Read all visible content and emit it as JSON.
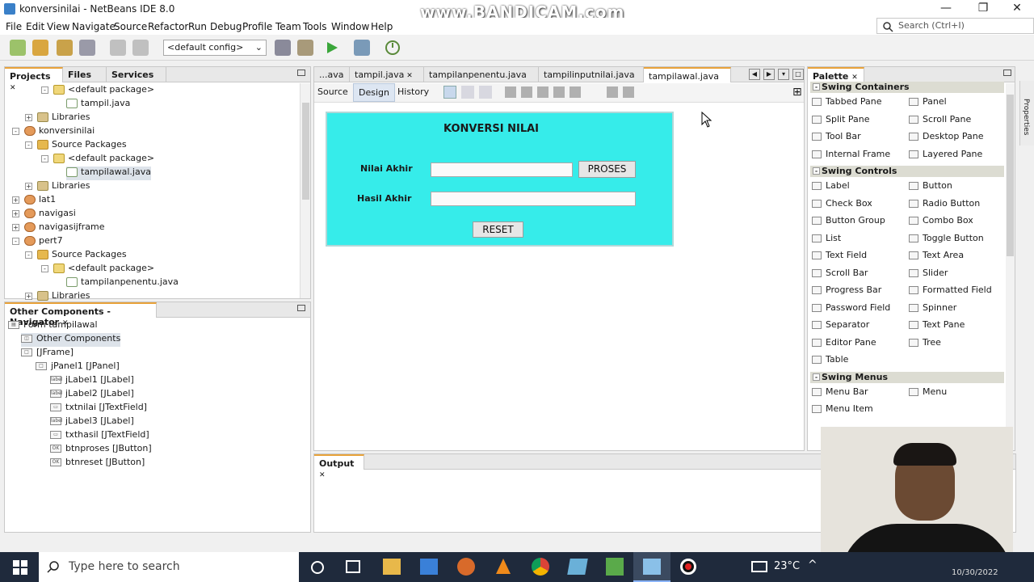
{
  "window": {
    "title": "konversinilai - NetBeans IDE 8.0",
    "minimize": "—",
    "maximize": "❐",
    "close": "✕"
  },
  "watermark": "www.BANDICAM.com",
  "menu": [
    "File",
    "Edit",
    "View",
    "Navigate",
    "Source",
    "Refactor",
    "Run",
    "Debug",
    "Profile",
    "Team",
    "Tools",
    "Window",
    "Help"
  ],
  "search": {
    "placeholder": "Search (Ctrl+I)"
  },
  "toolbar": {
    "config": "<default config>"
  },
  "projects": {
    "tabs": [
      "Projects",
      "Files",
      "Services"
    ],
    "tree": [
      {
        "label": "<default package>",
        "icon": "pkg"
      },
      {
        "label": "tampil.java",
        "icon": "java"
      },
      {
        "label": "Libraries",
        "icon": "lib"
      },
      {
        "label": "konversinilai",
        "icon": "proj"
      },
      {
        "label": "Source Packages",
        "icon": "folder"
      },
      {
        "label": "<default package>",
        "icon": "pkg"
      },
      {
        "label": "tampilawal.java",
        "icon": "java"
      },
      {
        "label": "Libraries",
        "icon": "lib"
      },
      {
        "label": "lat1",
        "icon": "proj"
      },
      {
        "label": "navigasi",
        "icon": "proj"
      },
      {
        "label": "navigasijframe",
        "icon": "proj"
      },
      {
        "label": "pert7",
        "icon": "proj"
      },
      {
        "label": "Source Packages",
        "icon": "folder"
      },
      {
        "label": "<default package>",
        "icon": "pkg"
      },
      {
        "label": "tampilanpenentu.java",
        "icon": "java"
      },
      {
        "label": "Libraries",
        "icon": "lib"
      }
    ]
  },
  "navigator": {
    "title": "Other Components - Navigator",
    "items": [
      {
        "label": "Form tampilawal",
        "icon": "form"
      },
      {
        "label": "Other Components",
        "icon": "comp"
      },
      {
        "label": "[JFrame]",
        "icon": "frame"
      },
      {
        "label": "jPanel1 [JPanel]",
        "icon": "panel"
      },
      {
        "label": "jLabel1 [JLabel]",
        "icon": "label"
      },
      {
        "label": "jLabel2 [JLabel]",
        "icon": "label"
      },
      {
        "label": "txtnilai [JTextField]",
        "icon": "field"
      },
      {
        "label": "jLabel3 [JLabel]",
        "icon": "label"
      },
      {
        "label": "txthasil [JTextField]",
        "icon": "field"
      },
      {
        "label": "btnproses [JButton]",
        "icon": "button"
      },
      {
        "label": "btnreset [JButton]",
        "icon": "button"
      }
    ]
  },
  "editor": {
    "tabs": [
      "...ava",
      "tampil.java",
      "tampilanpenentu.java",
      "tampilinputnilai.java",
      "tampilawal.java"
    ],
    "modes": [
      "Source",
      "Design",
      "History"
    ]
  },
  "form": {
    "title": "KONVERSI NILAI",
    "nilai_label": "Nilai Akhir",
    "hasil_label": "Hasil Akhir",
    "proses": "PROSES",
    "reset": "RESET",
    "bg_color": "#36ecea"
  },
  "output": {
    "title": "Output"
  },
  "palette": {
    "title": "Palette",
    "sections": [
      {
        "name": "Swing Containers",
        "items": [
          "Tabbed Pane",
          "Panel",
          "Split Pane",
          "Scroll Pane",
          "Tool Bar",
          "Desktop Pane",
          "Internal Frame",
          "Layered Pane"
        ]
      },
      {
        "name": "Swing Controls",
        "items": [
          "Label",
          "Button",
          "Check Box",
          "Radio Button",
          "Button Group",
          "Combo Box",
          "List",
          "Toggle Button",
          "Text Field",
          "Text Area",
          "Scroll Bar",
          "Slider",
          "Progress Bar",
          "Formatted Field",
          "Password Field",
          "Spinner",
          "Separator",
          "Text Pane",
          "Editor Pane",
          "Tree",
          "Table"
        ]
      },
      {
        "name": "Swing Menus",
        "items": [
          "Menu Bar",
          "Menu",
          "Menu Item"
        ]
      }
    ],
    "properties_tab": "Properties"
  },
  "taskbar": {
    "search": "Type here to search",
    "temperature": "23°C",
    "date": "10/30/2022"
  }
}
